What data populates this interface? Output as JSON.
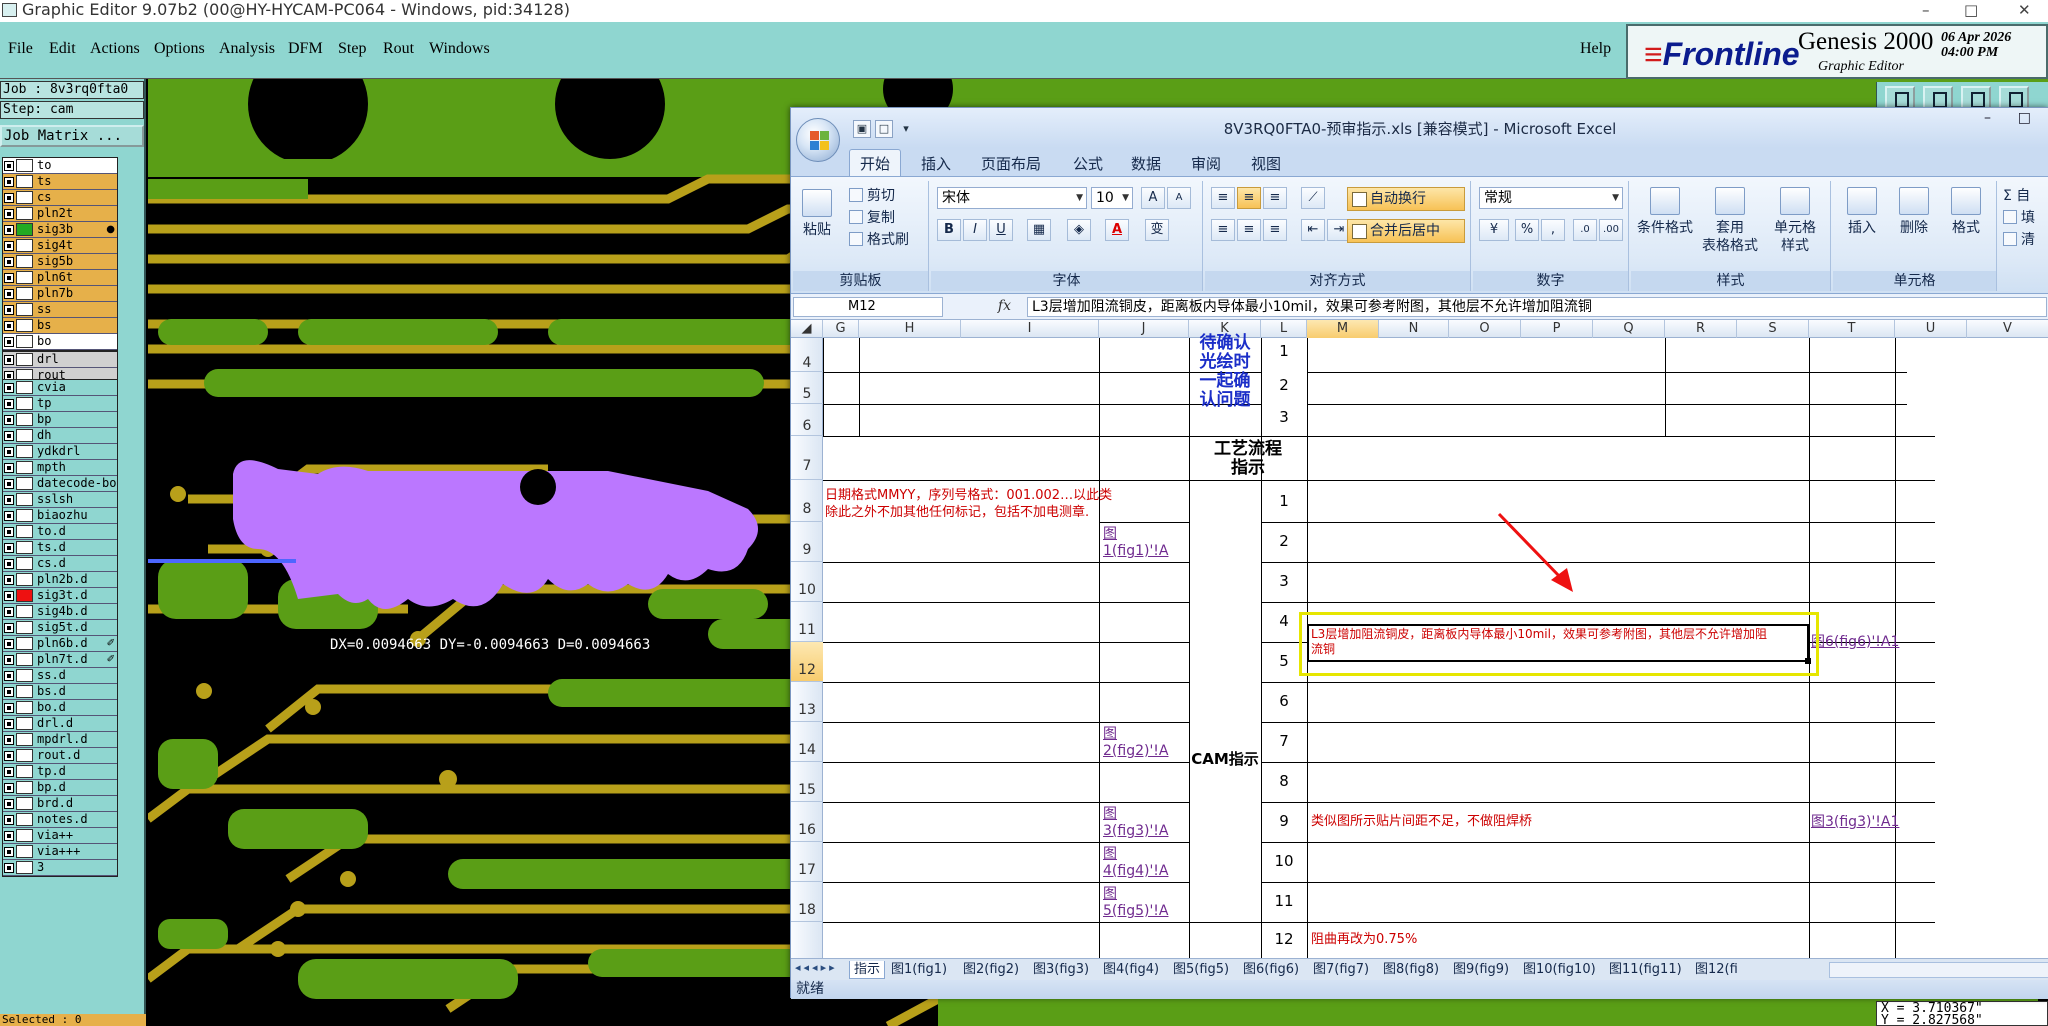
{
  "genesis": {
    "window_title": "Graphic Editor 9.07b2 (00@HY-HYCAM-PC064 - Windows, pid:34128)",
    "window_controls": [
      "–",
      "□",
      "✕"
    ],
    "menu": [
      "File",
      "Edit",
      "Actions",
      "Options",
      "Analysis",
      "DFM",
      "Step",
      "Rout",
      "Windows"
    ],
    "help": "Help",
    "brand": {
      "logo": "Frontline",
      "product": "Genesis 2000",
      "subtitle": "Graphic Editor",
      "date": "06 Apr 2026",
      "time": "04:00 PM"
    },
    "job": "Job : 8v3rq0fta0",
    "step": "Step: cam",
    "job_matrix": "Job Matrix ...",
    "layers_group1": [
      {
        "name": "to",
        "color": "#ffffff",
        "bg": "#ffffff"
      },
      {
        "name": "ts",
        "color": "#ffffff",
        "bg": "#e6b04a"
      },
      {
        "name": "cs",
        "color": "#ffffff",
        "bg": "#e6b04a"
      },
      {
        "name": "pln2t",
        "color": "#ffffff",
        "bg": "#e6b04a"
      },
      {
        "name": "sig3b",
        "color": "#22aa22",
        "bg": "#e6b04a",
        "mark": "●"
      },
      {
        "name": "sig4t",
        "color": "#ffffff",
        "bg": "#e6b04a"
      },
      {
        "name": "sig5b",
        "color": "#ffffff",
        "bg": "#e6b04a"
      },
      {
        "name": "pln6t",
        "color": "#ffffff",
        "bg": "#e6b04a"
      },
      {
        "name": "pln7b",
        "color": "#ffffff",
        "bg": "#e6b04a"
      },
      {
        "name": "ss",
        "color": "#ffffff",
        "bg": "#e6b04a"
      },
      {
        "name": "bs",
        "color": "#ffffff",
        "bg": "#e6b04a"
      },
      {
        "name": "bo",
        "color": "#ffffff",
        "bg": "#ffffff"
      }
    ],
    "layers_group2": [
      {
        "name": "drl",
        "color": "#ffffff",
        "bg": "#d0d0d0"
      },
      {
        "name": "rout",
        "color": "#ffffff",
        "bg": "#d0d0d0"
      }
    ],
    "layers_group3": [
      {
        "name": "cvia",
        "color": "#ffffff",
        "bg": "#8fd6d0"
      },
      {
        "name": "tp",
        "color": "#ffffff",
        "bg": "#8fd6d0"
      },
      {
        "name": "bp",
        "color": "#ffffff",
        "bg": "#8fd6d0"
      },
      {
        "name": "dh",
        "color": "#ffffff",
        "bg": "#8fd6d0"
      },
      {
        "name": "ydkdrl",
        "color": "#ffffff",
        "bg": "#8fd6d0"
      },
      {
        "name": "mpth",
        "color": "#ffffff",
        "bg": "#8fd6d0"
      },
      {
        "name": "datecode-bo",
        "color": "#ffffff",
        "bg": "#8fd6d0"
      },
      {
        "name": "sslsh",
        "color": "#ffffff",
        "bg": "#8fd6d0"
      },
      {
        "name": "biaozhu",
        "color": "#ffffff",
        "bg": "#8fd6d0"
      },
      {
        "name": "to.d",
        "color": "#ffffff",
        "bg": "#8fd6d0"
      },
      {
        "name": "ts.d",
        "color": "#ffffff",
        "bg": "#8fd6d0"
      },
      {
        "name": "cs.d",
        "color": "#ffffff",
        "bg": "#8fd6d0"
      },
      {
        "name": "pln2b.d",
        "color": "#ffffff",
        "bg": "#8fd6d0"
      },
      {
        "name": "sig3t.d",
        "color": "#ee1111",
        "bg": "#8fd6d0"
      },
      {
        "name": "sig4b.d",
        "color": "#ffffff",
        "bg": "#8fd6d0"
      },
      {
        "name": "sig5t.d",
        "color": "#ffffff",
        "bg": "#8fd6d0"
      },
      {
        "name": "pln6b.d",
        "color": "#ffffff",
        "bg": "#8fd6d0",
        "mark": "✐"
      },
      {
        "name": "pln7t.d",
        "color": "#ffffff",
        "bg": "#8fd6d0",
        "mark": "✐"
      },
      {
        "name": "ss.d",
        "color": "#ffffff",
        "bg": "#8fd6d0"
      },
      {
        "name": "bs.d",
        "color": "#ffffff",
        "bg": "#8fd6d0"
      },
      {
        "name": "bo.d",
        "color": "#ffffff",
        "bg": "#8fd6d0"
      },
      {
        "name": "drl.d",
        "color": "#ffffff",
        "bg": "#8fd6d0"
      },
      {
        "name": "mpdrl.d",
        "color": "#ffffff",
        "bg": "#8fd6d0"
      },
      {
        "name": "rout.d",
        "color": "#ffffff",
        "bg": "#8fd6d0"
      },
      {
        "name": "tp.d",
        "color": "#ffffff",
        "bg": "#8fd6d0"
      },
      {
        "name": "bp.d",
        "color": "#ffffff",
        "bg": "#8fd6d0"
      },
      {
        "name": "brd.d",
        "color": "#ffffff",
        "bg": "#8fd6d0"
      },
      {
        "name": "notes.d",
        "color": "#ffffff",
        "bg": "#8fd6d0"
      },
      {
        "name": "via++",
        "color": "#ffffff",
        "bg": "#8fd6d0"
      },
      {
        "name": "via+++",
        "color": "#ffffff",
        "bg": "#8fd6d0"
      },
      {
        "name": "3",
        "color": "#ffffff",
        "bg": "#8fd6d0"
      }
    ],
    "selected": "Selected : 0",
    "measure_text": "DX=0.0094663 DY=-0.0094663 D=0.0094663",
    "coords": {
      "x": "X = 3.710367\"",
      "y": "Y = 2.827568\""
    },
    "colors": {
      "board": "#5a9e16",
      "copper": "#b8a01a",
      "highlight": "#bb77ff",
      "panel": "#8fd6d0"
    }
  },
  "excel": {
    "title": "8V3RQ0FTA0-预审指示.xls  [兼容模式] - Microsoft Excel",
    "window_controls": [
      "–",
      "□"
    ],
    "tabs": [
      "开始",
      "插入",
      "页面布局",
      "公式",
      "数据",
      "审阅",
      "视图"
    ],
    "ribbon": {
      "clipboard": {
        "paste": "粘贴",
        "cut": "剪切",
        "copy": "复制",
        "format_painter": "格式刷",
        "label": "剪贴板"
      },
      "font": {
        "name": "宋体",
        "size": "10",
        "grow": "A",
        "shrink": "A",
        "bold": "B",
        "italic": "I",
        "underline": "U",
        "color": "A",
        "phonetic": "变",
        "label": "字体"
      },
      "alignment": {
        "wrap": "自动换行",
        "merge": "合并后居中",
        "label": "对齐方式"
      },
      "number": {
        "format": "常规",
        "percent": "%",
        "comma": ",",
        "label": "数字"
      },
      "styles": {
        "conditional": "条件格式",
        "table": "套用\n表格格式",
        "cell": "单元格\n样式",
        "label": "样式"
      },
      "cells": {
        "insert": "插入",
        "delete": "删除",
        "format": "格式",
        "label": "单元格"
      },
      "edit": {
        "sum": "Σ 自",
        "fill": "填",
        "clear": "清"
      }
    },
    "namebox": "M12",
    "fx": "fx",
    "formula": "L3层增加阻流铜皮，距离板内导体最小10mil，效果可参考附图，其他层不允许增加阻流铜",
    "columns": [
      "G",
      "H",
      "I",
      "J",
      "K",
      "L",
      "M",
      "N",
      "O",
      "P",
      "Q",
      "R",
      "S",
      "T",
      "U",
      "V"
    ],
    "rows": [
      "4",
      "5",
      "6",
      "7",
      "8",
      "9",
      "10",
      "11",
      "12",
      "13",
      "14",
      "15",
      "16",
      "17",
      "18"
    ],
    "cells": {
      "k_top": "待确认\n光绘时\n一起确\n认问题",
      "k7": "工艺流程\n指示",
      "k_cam": "CAM指示",
      "l_nums_top": [
        "1",
        "2",
        "3"
      ],
      "l_nums": [
        "1",
        "2",
        "3",
        "4",
        "5",
        "6",
        "7",
        "8",
        "9",
        "10",
        "11"
      ],
      "row8_text1": "日期格式MMYY，序列号格式：001.002…以此类",
      "row8_text2": "除此之外不加其他任何标记，包括不加电测章.",
      "j9": "图\n1(fig1)'!A",
      "j14": "图\n2(fig2)'!A",
      "j16": "图\n3(fig3)'!A",
      "j17": "图\n4(fig4)'!A",
      "j18": "图\n5(fig5)'!A",
      "m12": "L3层增加阻流铜皮，距离板内导体最小10mil，效果可参考附图，其他层不允许增加阻\n流铜",
      "t12": "图6(fig6)'!A1",
      "m16": "类似图所示贴片间距不足，不做阻焊桥",
      "t16": "图3(fig3)'!A1",
      "row19_partial": "12",
      "row19_text": "阻曲再改为0.75%"
    },
    "sheet_tabs": [
      "指示",
      "图1(fig1)",
      "图2(fig2)",
      "图3(fig3)",
      "图4(fig4)",
      "图5(fig5)",
      "图6(fig6)",
      "图7(fig7)",
      "图8(fig8)",
      "图9(fig9)",
      "图10(fig10)",
      "图11(fig11)",
      "图12(fi"
    ],
    "status": "就绪",
    "colors": {
      "annotation_box": "#e6e600",
      "arrow": "#ee1111"
    }
  }
}
